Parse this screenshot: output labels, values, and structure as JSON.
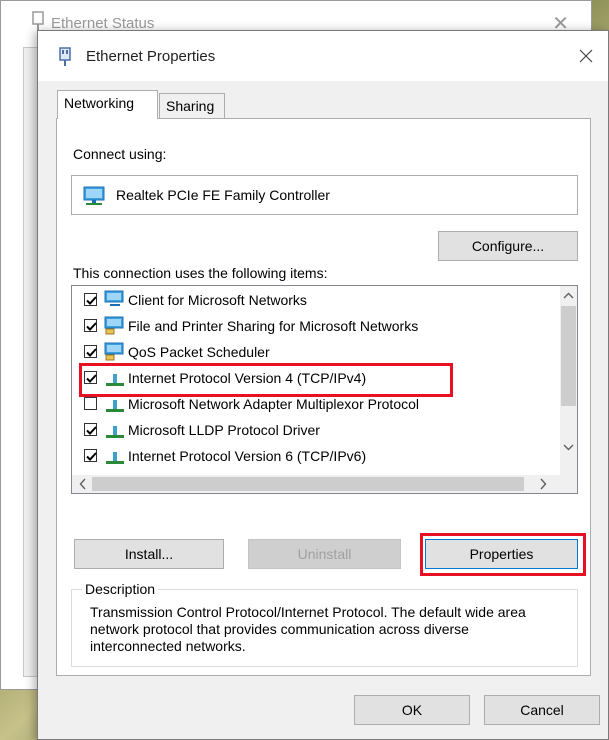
{
  "background_window": {
    "title": "Ethernet Status"
  },
  "dialog": {
    "title": "Ethernet Properties",
    "close_glyph": "✕"
  },
  "tabs": [
    {
      "label": "Networking",
      "active": true
    },
    {
      "label": "Sharing",
      "active": false
    }
  ],
  "networking": {
    "connect_using_label": "Connect using:",
    "adapter_name": "Realtek PCIe FE Family Controller",
    "configure_label": "Configure...",
    "items_label": "This connection uses the following items:",
    "items": [
      {
        "label": "Client for Microsoft Networks",
        "checked": true,
        "icon": "network-client-icon"
      },
      {
        "label": "File and Printer Sharing for Microsoft Networks",
        "checked": true,
        "icon": "network-service-icon"
      },
      {
        "label": "QoS Packet Scheduler",
        "checked": true,
        "icon": "network-service-icon"
      },
      {
        "label": "Internet Protocol Version 4 (TCP/IPv4)",
        "checked": true,
        "icon": "protocol-icon",
        "highlighted": true
      },
      {
        "label": "Microsoft Network Adapter Multiplexor Protocol",
        "checked": false,
        "icon": "protocol-icon"
      },
      {
        "label": "Microsoft LLDP Protocol Driver",
        "checked": true,
        "icon": "protocol-icon"
      },
      {
        "label": "Internet Protocol Version 6 (TCP/IPv6)",
        "checked": true,
        "icon": "protocol-icon"
      }
    ],
    "install_label": "Install...",
    "uninstall_label": "Uninstall",
    "properties_label": "Properties",
    "description_title": "Description",
    "description_text": "Transmission Control Protocol/Internet Protocol. The default wide area network protocol that provides communication across diverse interconnected networks."
  },
  "footer": {
    "ok_label": "OK",
    "cancel_label": "Cancel"
  },
  "colors": {
    "highlight": "#e81123",
    "dialog_bg": "#f0f0f0",
    "button_bg": "#e1e1e1"
  }
}
